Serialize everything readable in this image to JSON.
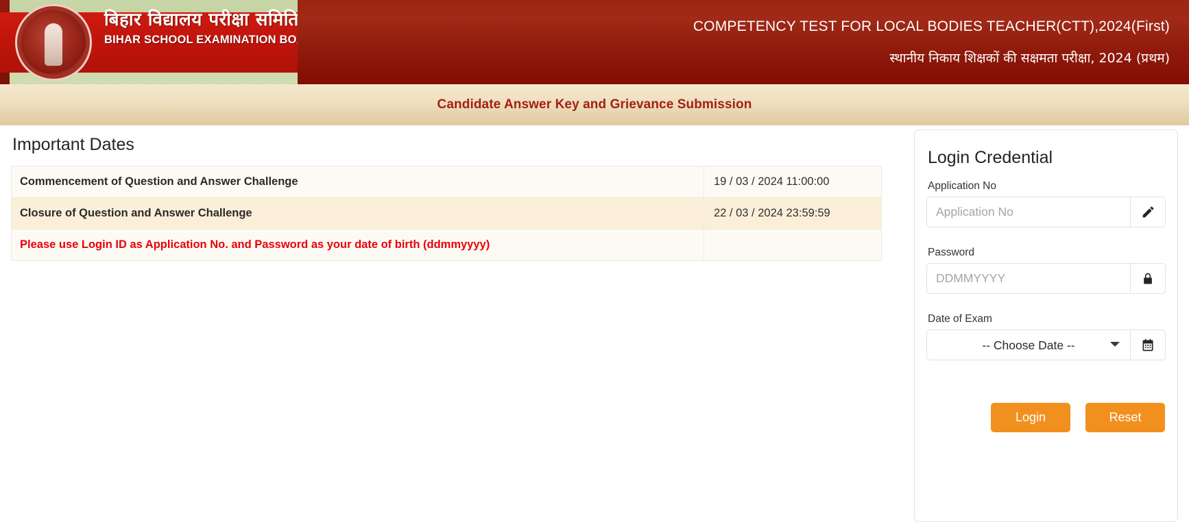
{
  "header": {
    "logo": {
      "hindi_name": "बिहार विद्यालय परीक्षा समिति",
      "english_name": "BIHAR SCHOOL EXAMINATION BOARD",
      "seal_alt": "bseb-seal"
    },
    "title_english": "COMPETENCY TEST FOR LOCAL BODIES TEACHER(CTT),2024(First)",
    "title_hindi": "स्थानीय निकाय शिक्षकों की सक्षमता परीक्षा, 2024 (प्रथम)"
  },
  "subbar": {
    "text": "Candidate Answer Key and Grievance Submission"
  },
  "important_dates": {
    "heading": "Important Dates",
    "rows": [
      {
        "label": "Commencement of Question and Answer Challenge",
        "value": "19 / 03 / 2024 11:00:00",
        "is_warning": false
      },
      {
        "label": "Closure of Question and Answer Challenge",
        "value": "22 / 03 / 2024 23:59:59",
        "is_warning": false
      },
      {
        "label": "Please use Login ID as Application No. and Password as your date of birth (ddmmyyyy)",
        "value": "",
        "is_warning": true
      }
    ]
  },
  "login": {
    "title": "Login Credential",
    "application_no": {
      "label": "Application No",
      "placeholder": "Application No",
      "value": "",
      "addon_icon": "pencil-icon"
    },
    "password": {
      "label": "Password",
      "placeholder": "DDMMYYYY",
      "value": "",
      "addon_icon": "lock-icon"
    },
    "date_of_exam": {
      "label": "Date of Exam",
      "selected": "-- Choose Date --",
      "options": [
        "-- Choose Date --"
      ],
      "addon_icon": "calendar-icon"
    },
    "login_button": "Login",
    "reset_button": "Reset"
  },
  "colors": {
    "header_red_top": "#9c2414",
    "header_red_bottom": "#820d03",
    "subbar_top": "#f6e8cd",
    "subbar_bottom": "#e0c99f",
    "subbar_text": "#a31f15",
    "warning_red": "#e8000b",
    "button_orange": "#f2901f",
    "row_light": "#fdfaf4",
    "row_tan": "#fcefd9"
  }
}
